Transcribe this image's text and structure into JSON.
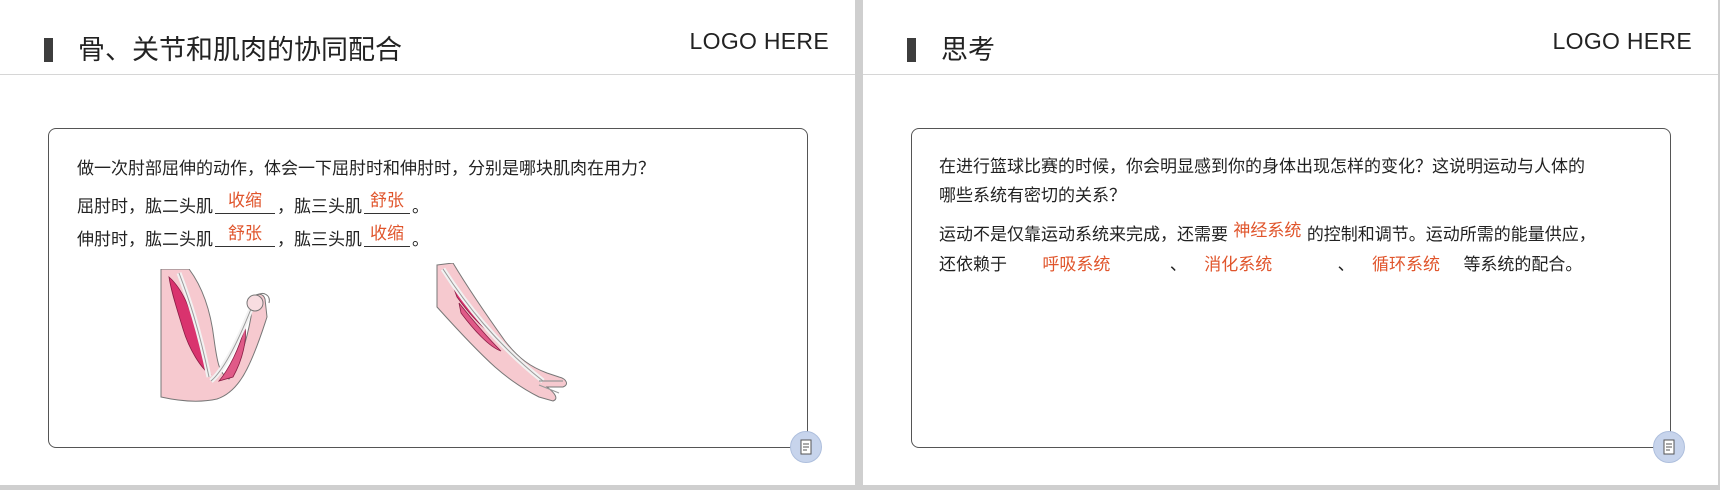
{
  "left_slide": {
    "title": "骨、关节和肌肉的协同配合",
    "logo": "LOGO HERE",
    "question": "做一次肘部屈伸的动作，体会一下屈肘时和伸肘时，分别是哪块肌肉在用力？",
    "line1": {
      "prefix": "屈肘时，肱二头肌",
      "answer1": "收缩",
      "middle": "，肱三头肌",
      "answer2": "舒张",
      "suffix": "。"
    },
    "line2": {
      "prefix": "伸肘时，肱二头肌",
      "answer1": "舒张",
      "middle": "，肱三头肌",
      "answer2": "收缩",
      "suffix": "。"
    },
    "figures": [
      "flexed-arm-illustration",
      "extended-arm-illustration"
    ],
    "corner_icon": "document-icon"
  },
  "right_slide": {
    "title": "思考",
    "logo": "LOGO HERE",
    "paragraph1_line1": "在进行篮球比赛的时候，你会明显感到你的身体出现怎样的变化？这说明运动与人体的",
    "paragraph1_line2": "哪些系统有密切的关系？",
    "paragraph2_line1": {
      "prefix": "运动不是仅靠运动系统来完成，还需要",
      "answer": "神经系统",
      "suffix": "的控制和调节。运动所需的能量供应，"
    },
    "paragraph2_line2": {
      "prefix": "还依赖于",
      "answer1": "呼吸系统",
      "sep1": "、",
      "answer2": "消化系统",
      "sep2": "、",
      "answer3": "循环系统",
      "suffix": "等系统的配合。"
    },
    "corner_icon": "document-icon"
  },
  "colors": {
    "answer": "#e0552c",
    "title_bar": "#3d3d3d",
    "box_border": "#555555",
    "muscle": "#d9336e",
    "skin": "#f6c9cf"
  }
}
